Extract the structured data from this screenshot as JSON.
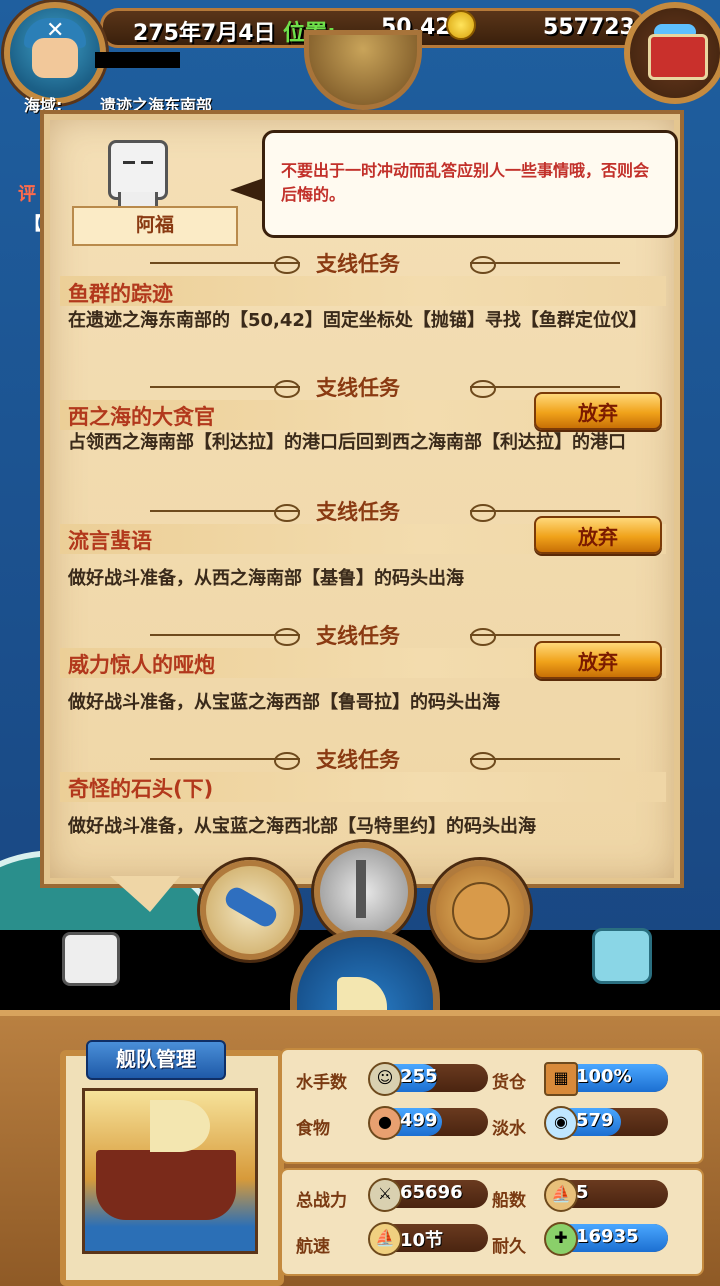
{
  "hud": {
    "date": "275年7月4日",
    "position_label": "位置:",
    "position": "50,42",
    "gold": "557723"
  },
  "region": {
    "label": "海域:",
    "name": "遗迹之海东南部"
  },
  "side_fragments": {
    "left1": "评",
    "left2": "【"
  },
  "dialog": {
    "npc_name": "阿福",
    "text": "不要出于一时冲动而乱答应别人一些事情哦，否则会后悔的。"
  },
  "quests": [
    {
      "section": "支线任务",
      "name": "鱼群的踪迹",
      "desc": "在遗迹之海东南部的【50,42】固定坐标处【抛锚】寻找【鱼群定位仪】",
      "abandon": null
    },
    {
      "section": "支线任务",
      "name": "西之海的大贪官",
      "desc": "占领西之海南部【利达拉】的港口后回到西之海南部【利达拉】的港口",
      "abandon": "放弃"
    },
    {
      "section": "支线任务",
      "name": "流言蜚语",
      "desc": "做好战斗准备，从西之海南部【基鲁】的码头出海",
      "abandon": "放弃"
    },
    {
      "section": "支线任务",
      "name": "威力惊人的哑炮",
      "desc": "做好战斗准备，从宝蓝之海西部【鲁哥拉】的码头出海",
      "abandon": "放弃"
    },
    {
      "section": "支线任务",
      "name": "奇怪的石头(下)",
      "desc": "做好战斗准备，从宝蓝之海西北部【马特里约】的码头出海",
      "abandon": null
    }
  ],
  "fleet": {
    "title": "舰队管理",
    "stats": {
      "sailors": {
        "label": "水手数",
        "value": "255",
        "fill": 0.55
      },
      "cargo": {
        "label": "货仓",
        "value": "100%",
        "fill": 1.0
      },
      "food": {
        "label": "食物",
        "value": "499",
        "fill": 0.6
      },
      "water": {
        "label": "淡水",
        "value": "579",
        "fill": 0.6
      },
      "power": {
        "label": "总战力",
        "value": "65696",
        "fill": 0
      },
      "ships": {
        "label": "船数",
        "value": "5",
        "fill": 0
      },
      "speed": {
        "label": "航速",
        "value": "10节",
        "fill": 0
      },
      "durability": {
        "label": "耐久",
        "value": "16935",
        "fill": 1.0
      }
    }
  },
  "colors": {
    "accent_red": "#b2381c",
    "button_orange": "#f0a21a",
    "bar_blue": "#1c6fd1"
  }
}
